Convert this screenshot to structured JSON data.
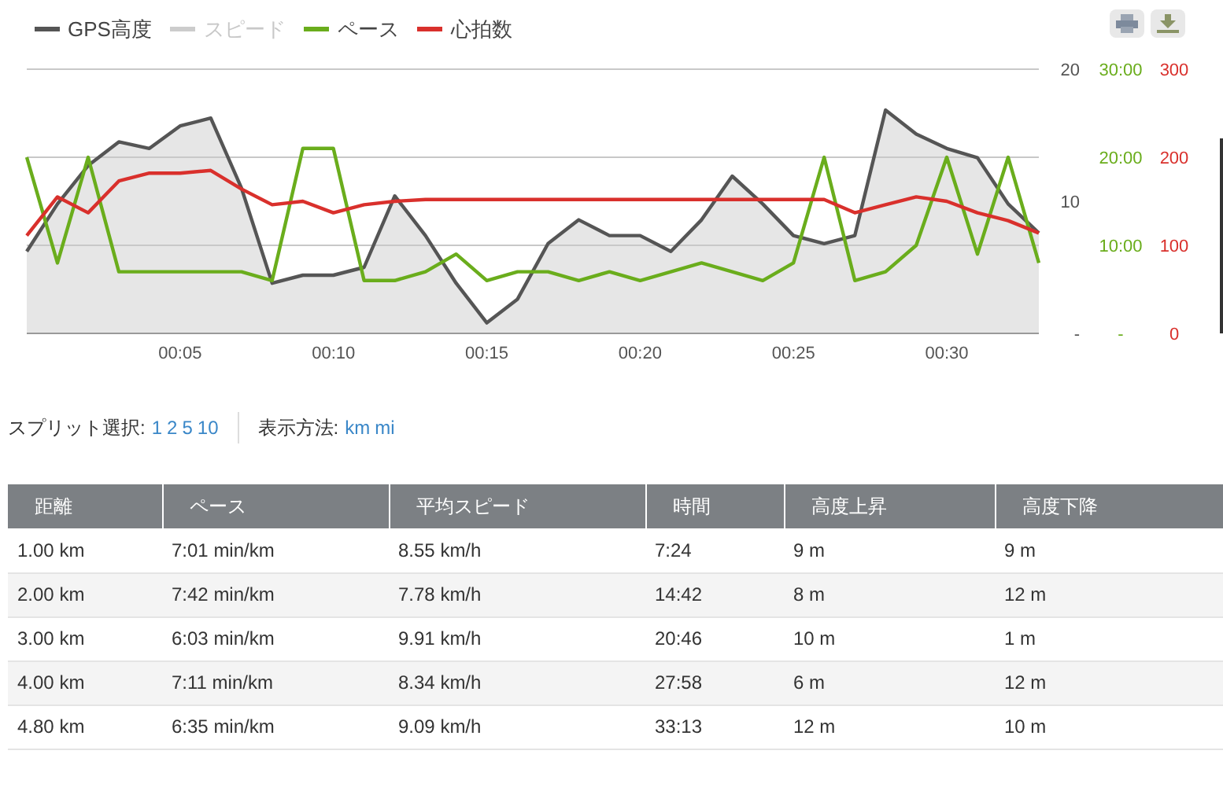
{
  "legend": [
    {
      "label": "GPS高度",
      "color": "#555555",
      "visible": true
    },
    {
      "label": "スピード",
      "color": "#cccccc",
      "visible": false
    },
    {
      "label": "ペース",
      "color": "#6aad1c",
      "visible": true
    },
    {
      "label": "心拍数",
      "color": "#d9302c",
      "visible": true
    }
  ],
  "chart_data": {
    "type": "line",
    "x": [
      0,
      1,
      2,
      3,
      4,
      5,
      6,
      7,
      8,
      9,
      10,
      11,
      12,
      13,
      14,
      15,
      16,
      17,
      18,
      19,
      20,
      21,
      22,
      23,
      24,
      25,
      26,
      27,
      28,
      29,
      30,
      31,
      32,
      33
    ],
    "xlim": [
      0,
      33
    ],
    "xticks": [
      {
        "value": 5,
        "label": "00:05"
      },
      {
        "value": 10,
        "label": "00:10"
      },
      {
        "value": 15,
        "label": "00:15"
      },
      {
        "value": 20,
        "label": "00:20"
      },
      {
        "value": 25,
        "label": "00:25"
      },
      {
        "value": 30,
        "label": "00:30"
      }
    ],
    "ylim": [
      0,
      20
    ],
    "yticks": [
      {
        "value": 0,
        "label": "-"
      },
      {
        "value": 10,
        "label": "10"
      },
      {
        "value": 20,
        "label": "20"
      }
    ],
    "y2lim": [
      0,
      30
    ],
    "y2ticks": [
      {
        "value": 0,
        "label": "-"
      },
      {
        "value": 10,
        "label": "10:00"
      },
      {
        "value": 20,
        "label": "20:00"
      },
      {
        "value": 30,
        "label": "30:00"
      }
    ],
    "y3lim": [
      0,
      300
    ],
    "y3ticks": [
      {
        "value": 0,
        "label": "0"
      },
      {
        "value": 100,
        "label": "100"
      },
      {
        "value": 200,
        "label": "200"
      },
      {
        "value": 300,
        "label": "300"
      }
    ],
    "series": [
      {
        "type": "area",
        "color": "#555555",
        "values": [
          6.2,
          9.8,
          12.7,
          14.5,
          14,
          15.7,
          16.3,
          11,
          3.8,
          4.4,
          4.4,
          5,
          10.4,
          7.4,
          3.8,
          0.8,
          2.6,
          6.8,
          8.6,
          7.4,
          7.4,
          6.2,
          8.6,
          11.9,
          9.8,
          7.4,
          6.8,
          7.4,
          16.9,
          15.1,
          14,
          13.3,
          9.8,
          7.6
        ]
      },
      {
        "color": "#6aad1c",
        "axis": "y2",
        "values": [
          20,
          8,
          20,
          7,
          7,
          7,
          7,
          7,
          6,
          21,
          21,
          6,
          6,
          7,
          9,
          6,
          7,
          7,
          6,
          7,
          6,
          7,
          8,
          7,
          6,
          8,
          20,
          6,
          7,
          10,
          20,
          9,
          20,
          8
        ]
      },
      {
        "color": "#d9302c",
        "axis": "y3",
        "values": [
          111,
          155,
          137,
          173,
          182,
          182,
          185,
          164,
          146,
          150,
          137,
          146,
          150,
          152,
          152,
          152,
          152,
          152,
          152,
          152,
          152,
          152,
          152,
          152,
          152,
          152,
          152,
          137,
          146,
          155,
          150,
          137,
          128,
          114
        ]
      }
    ]
  },
  "split": {
    "label": "スプリット選択:",
    "options": [
      "1",
      "2",
      "5",
      "10"
    ]
  },
  "display": {
    "label": "表示方法:",
    "options": [
      "km",
      "mi"
    ]
  },
  "table": {
    "columns": [
      "距離",
      "ペース",
      "平均スピード",
      "時間",
      "高度上昇",
      "高度下降"
    ],
    "rows": [
      [
        "1.00 km",
        "7:01 min/km",
        "8.55 km/h",
        "7:24",
        "9 m",
        "9 m"
      ],
      [
        "2.00 km",
        "7:42 min/km",
        "7.78 km/h",
        "14:42",
        "8 m",
        "12 m"
      ],
      [
        "3.00 km",
        "6:03 min/km",
        "9.91 km/h",
        "20:46",
        "10 m",
        "1 m"
      ],
      [
        "4.00 km",
        "7:11 min/km",
        "8.34 km/h",
        "27:58",
        "6 m",
        "12 m"
      ],
      [
        "4.80 km",
        "6:35 min/km",
        "9.09 km/h",
        "33:13",
        "12 m",
        "10 m"
      ]
    ]
  }
}
